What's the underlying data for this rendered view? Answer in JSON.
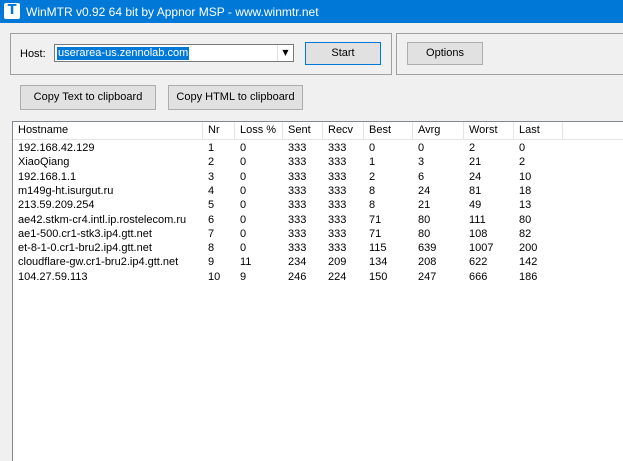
{
  "window": {
    "title": "WinMTR v0.92 64 bit by Appnor MSP - www.winmtr.net",
    "icon": "winmtr-app-icon",
    "icon_glyph": "T"
  },
  "host": {
    "label": "Host:",
    "value": "userarea-us.zennolab.com",
    "arrow_glyph": "▼"
  },
  "buttons": {
    "start": "Start",
    "options": "Options",
    "copy_text": "Copy Text to clipboard",
    "copy_html": "Copy HTML to clipboard"
  },
  "table": {
    "columns": [
      "Hostname",
      "Nr",
      "Loss %",
      "Sent",
      "Recv",
      "Best",
      "Avrg",
      "Worst",
      "Last"
    ],
    "rows": [
      [
        "192.168.42.129",
        "1",
        "0",
        "333",
        "333",
        "0",
        "0",
        "2",
        "0"
      ],
      [
        "XiaoQiang",
        "2",
        "0",
        "333",
        "333",
        "1",
        "3",
        "21",
        "2"
      ],
      [
        "192.168.1.1",
        "3",
        "0",
        "333",
        "333",
        "2",
        "6",
        "24",
        "10"
      ],
      [
        "m149g-ht.isurgut.ru",
        "4",
        "0",
        "333",
        "333",
        "8",
        "24",
        "81",
        "18"
      ],
      [
        "213.59.209.254",
        "5",
        "0",
        "333",
        "333",
        "8",
        "21",
        "49",
        "13"
      ],
      [
        "ae42.stkm-cr4.intl.ip.rostelecom.ru",
        "6",
        "0",
        "333",
        "333",
        "71",
        "80",
        "111",
        "80"
      ],
      [
        "ae1-500.cr1-stk3.ip4.gtt.net",
        "7",
        "0",
        "333",
        "333",
        "71",
        "80",
        "108",
        "82"
      ],
      [
        "et-8-1-0.cr1-bru2.ip4.gtt.net",
        "8",
        "0",
        "333",
        "333",
        "115",
        "639",
        "1007",
        "200"
      ],
      [
        "cloudflare-gw.cr1-bru2.ip4.gtt.net",
        "9",
        "11",
        "234",
        "209",
        "134",
        "208",
        "622",
        "142"
      ],
      [
        "104.27.59.113",
        "10",
        "9",
        "246",
        "224",
        "150",
        "247",
        "666",
        "186"
      ]
    ]
  }
}
